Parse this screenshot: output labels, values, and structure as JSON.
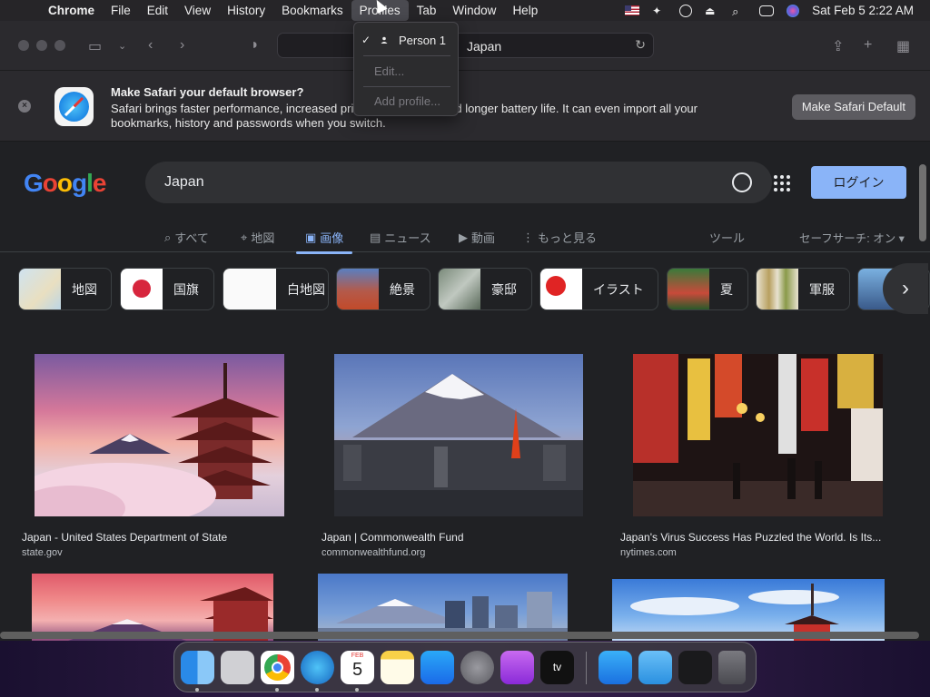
{
  "menubar": {
    "app": "Chrome",
    "items": [
      "File",
      "Edit",
      "View",
      "History",
      "Bookmarks",
      "Profiles",
      "Tab",
      "Window",
      "Help"
    ],
    "active": "Profiles",
    "clock": "Sat Feb 5  2:22 AM"
  },
  "profiles_menu": {
    "items": [
      {
        "label": "Person 1",
        "checked": true,
        "enabled": true
      },
      {
        "label": "Edit...",
        "enabled": false
      },
      {
        "label": "Add profile...",
        "enabled": false
      }
    ]
  },
  "toolbar": {
    "address": "Japan"
  },
  "banner": {
    "title": "Make Safari your default browser?",
    "description": "Safari brings faster performance, increased privacy protections and longer battery life. It can even import all your bookmarks, history and passwords when you switch.",
    "button": "Make Safari Default"
  },
  "google": {
    "query": "Japan",
    "login": "ログイン",
    "tabs": [
      {
        "label": "すべて",
        "icon": "search-icon"
      },
      {
        "label": "地図",
        "icon": "map-pin-icon"
      },
      {
        "label": "画像",
        "icon": "image-icon",
        "active": true
      },
      {
        "label": "ニュース",
        "icon": "news-icon"
      },
      {
        "label": "動画",
        "icon": "video-icon"
      },
      {
        "label": "もっと見る",
        "icon": "more-vertical-icon"
      }
    ],
    "tools": "ツール",
    "safesearch": "セーフサーチ: オン",
    "chips": [
      "地図",
      "国旗",
      "白地図",
      "絶景",
      "豪邸",
      "イラスト",
      "夏",
      "軍服"
    ],
    "results": [
      {
        "title": "Japan - United States Department of State",
        "source": "state.gov"
      },
      {
        "title": "Japan | Commonwealth Fund",
        "source": "commonwealthfund.org"
      },
      {
        "title": "Japan's Virus Success Has Puzzled the World. Is Its...",
        "source": "nytimes.com"
      }
    ]
  },
  "dock": {
    "apps": [
      "Finder",
      "Launchpad",
      "Chrome",
      "Safari",
      "Calendar",
      "Notes",
      "App Store",
      "System Preferences",
      "Podcasts",
      "TV",
      "App Store Folder",
      "Downloads",
      "Recent",
      "Trash"
    ],
    "calendar": {
      "month": "FEB",
      "day": "5"
    }
  }
}
